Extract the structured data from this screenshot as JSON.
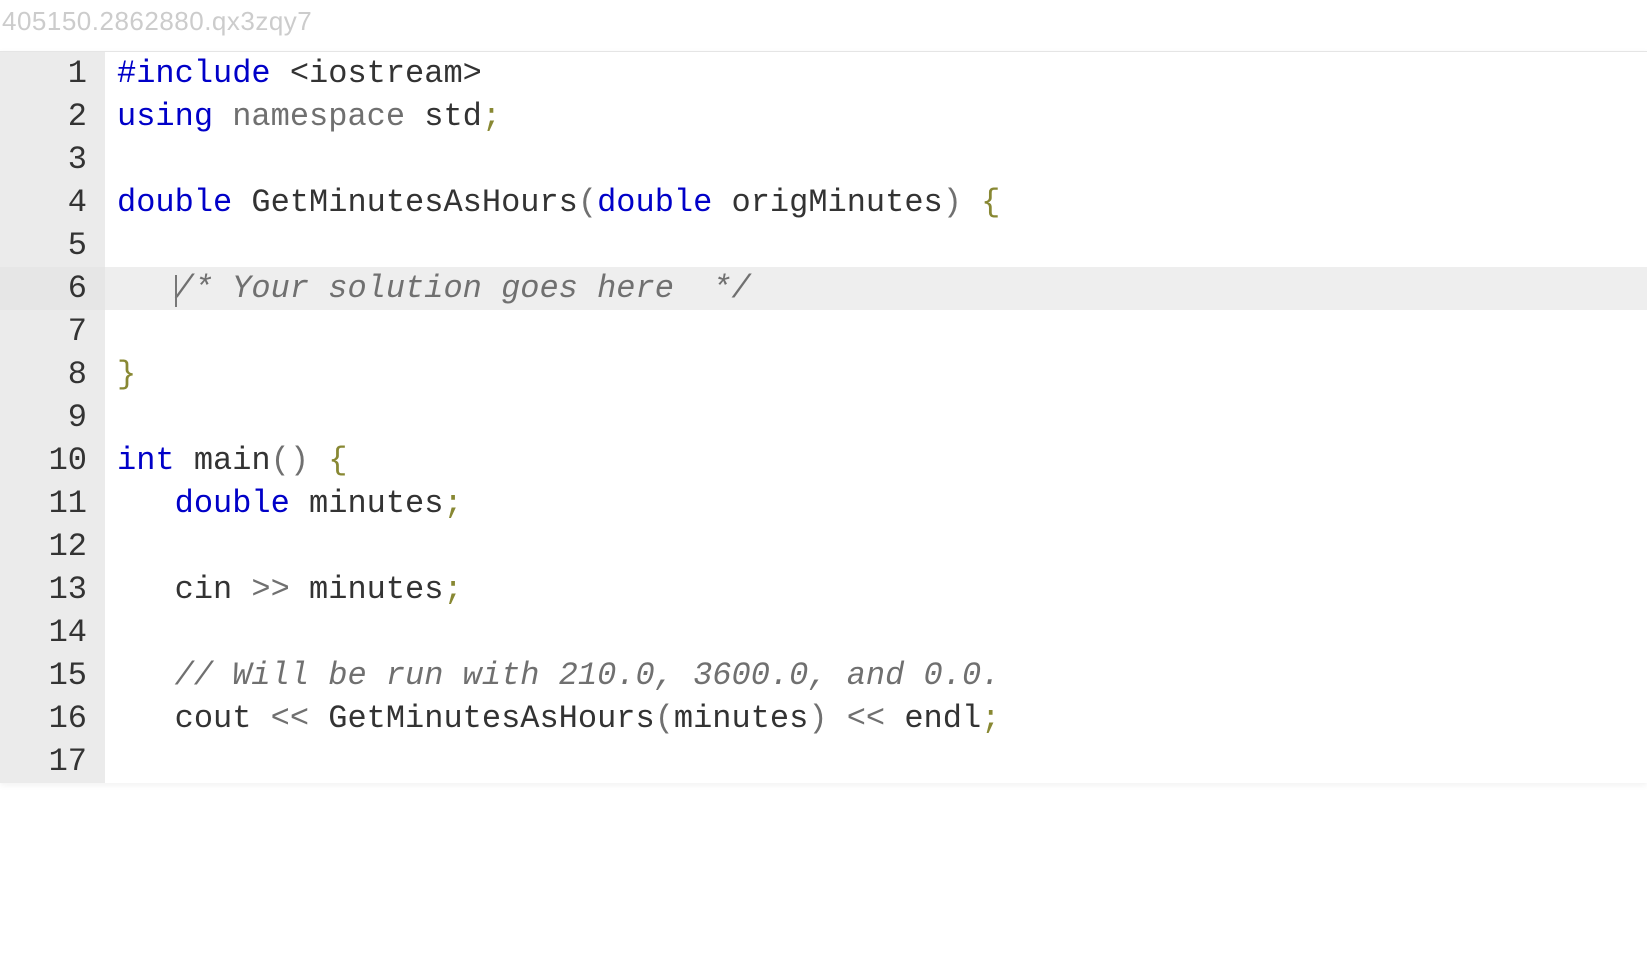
{
  "header_id": "405150.2862880.qx3zqy7",
  "editable_line": 6,
  "code_lines": [
    {
      "n": 1,
      "tokens": [
        {
          "t": "#include",
          "c": "tk-keyword"
        },
        {
          "t": " "
        },
        {
          "t": "<iostream>",
          "c": "tk-angle"
        }
      ]
    },
    {
      "n": 2,
      "tokens": [
        {
          "t": "using",
          "c": "tk-keyword"
        },
        {
          "t": " "
        },
        {
          "t": "namespace",
          "c": "tk-namespace"
        },
        {
          "t": " "
        },
        {
          "t": "std",
          "c": "tk-ident"
        },
        {
          "t": ";",
          "c": "tk-semi"
        }
      ]
    },
    {
      "n": 3,
      "tokens": []
    },
    {
      "n": 4,
      "tokens": [
        {
          "t": "double",
          "c": "tk-keyword"
        },
        {
          "t": " "
        },
        {
          "t": "GetMinutesAsHours",
          "c": "tk-ident"
        },
        {
          "t": "(",
          "c": "tk-paren"
        },
        {
          "t": "double",
          "c": "tk-keyword"
        },
        {
          "t": " "
        },
        {
          "t": "origMinutes",
          "c": "tk-ident"
        },
        {
          "t": ")",
          "c": "tk-paren"
        },
        {
          "t": " "
        },
        {
          "t": "{",
          "c": "tk-brace"
        }
      ]
    },
    {
      "n": 5,
      "tokens": []
    },
    {
      "n": 6,
      "tokens": [
        {
          "t": "   "
        },
        {
          "t": "/* Your solution goes here  */",
          "c": "tk-comment"
        }
      ]
    },
    {
      "n": 7,
      "tokens": []
    },
    {
      "n": 8,
      "tokens": [
        {
          "t": "}",
          "c": "tk-brace"
        }
      ]
    },
    {
      "n": 9,
      "tokens": []
    },
    {
      "n": 10,
      "tokens": [
        {
          "t": "int",
          "c": "tk-keyword"
        },
        {
          "t": " "
        },
        {
          "t": "main",
          "c": "tk-ident"
        },
        {
          "t": "()",
          "c": "tk-paren"
        },
        {
          "t": " "
        },
        {
          "t": "{",
          "c": "tk-brace"
        }
      ]
    },
    {
      "n": 11,
      "tokens": [
        {
          "t": "   "
        },
        {
          "t": "double",
          "c": "tk-keyword"
        },
        {
          "t": " "
        },
        {
          "t": "minutes",
          "c": "tk-ident"
        },
        {
          "t": ";",
          "c": "tk-semi"
        }
      ]
    },
    {
      "n": 12,
      "tokens": []
    },
    {
      "n": 13,
      "tokens": [
        {
          "t": "   "
        },
        {
          "t": "cin",
          "c": "tk-ident"
        },
        {
          "t": " "
        },
        {
          "t": ">>",
          "c": "tk-op"
        },
        {
          "t": " "
        },
        {
          "t": "minutes",
          "c": "tk-ident"
        },
        {
          "t": ";",
          "c": "tk-semi"
        }
      ]
    },
    {
      "n": 14,
      "tokens": []
    },
    {
      "n": 15,
      "tokens": [
        {
          "t": "   "
        },
        {
          "t": "// Will be run with 210.0, 3600.0, and 0.0.",
          "c": "tk-comment"
        }
      ]
    },
    {
      "n": 16,
      "tokens": [
        {
          "t": "   "
        },
        {
          "t": "cout",
          "c": "tk-ident"
        },
        {
          "t": " "
        },
        {
          "t": "<<",
          "c": "tk-op"
        },
        {
          "t": " "
        },
        {
          "t": "GetMinutesAsHours",
          "c": "tk-ident"
        },
        {
          "t": "(",
          "c": "tk-paren"
        },
        {
          "t": "minutes",
          "c": "tk-ident"
        },
        {
          "t": ")",
          "c": "tk-paren"
        },
        {
          "t": " "
        },
        {
          "t": "<<",
          "c": "tk-op"
        },
        {
          "t": " "
        },
        {
          "t": "endl",
          "c": "tk-ident"
        },
        {
          "t": ";",
          "c": "tk-semi"
        }
      ]
    },
    {
      "n": 17,
      "tokens": []
    }
  ]
}
